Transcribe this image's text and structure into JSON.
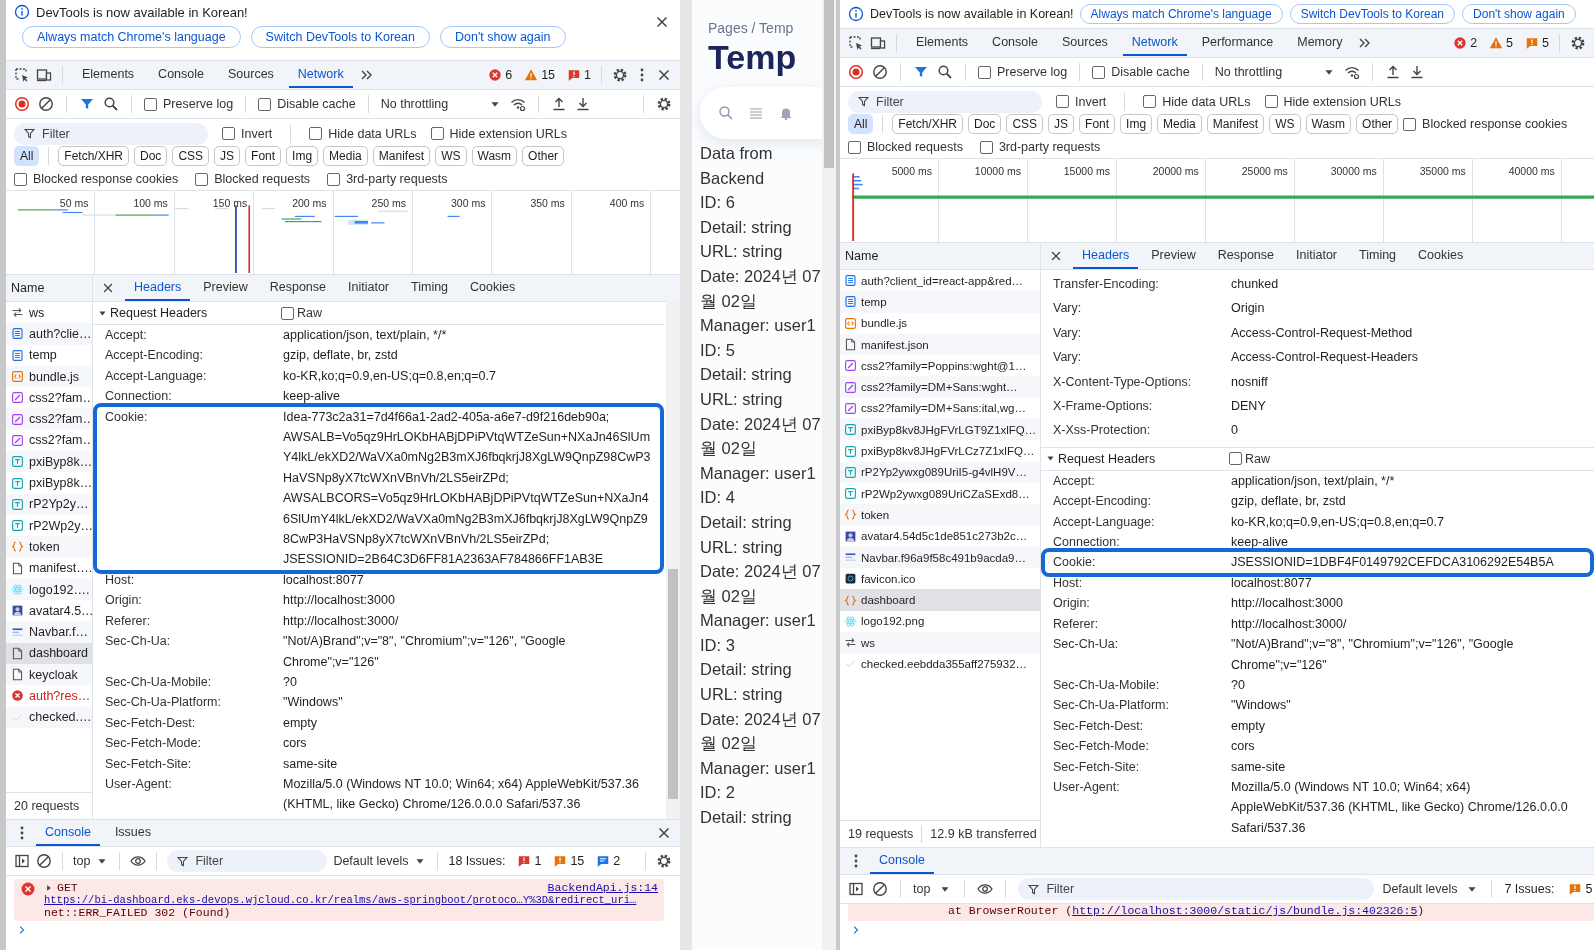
{
  "devtools": [
    {
      "infobar": {
        "message": "DevTools is now available in Korean!",
        "buttons": [
          "Always match Chrome's language",
          "Switch DevTools to Korean",
          "Don't show again"
        ]
      },
      "tabs": [
        {
          "label": "Elements",
          "selected": false
        },
        {
          "label": "Console",
          "selected": false
        },
        {
          "label": "Sources",
          "selected": false
        },
        {
          "label": "Network",
          "selected": true
        }
      ],
      "counts": [
        {
          "kind": "error",
          "text": "6"
        },
        {
          "kind": "warning",
          "text": "15"
        },
        {
          "kind": "error_issue",
          "text": "1"
        }
      ],
      "toolbar_checks": [
        {
          "label": "Preserve log",
          "checked": false
        },
        {
          "label": "Disable cache",
          "checked": false
        }
      ],
      "throttling": "No throttling",
      "filter": {
        "placeholder": "Filter"
      },
      "filter_checks": [
        {
          "label": "Invert",
          "checked": false
        },
        {
          "label": "Hide data URLs",
          "checked": false
        },
        {
          "label": "Hide extension URLs",
          "checked": false
        }
      ],
      "types": [
        {
          "label": "All",
          "selected": true
        },
        {
          "label": "Fetch/XHR",
          "selected": false
        },
        {
          "label": "Doc",
          "selected": false
        },
        {
          "label": "CSS",
          "selected": false
        },
        {
          "label": "JS",
          "selected": false
        },
        {
          "label": "Font",
          "selected": false
        },
        {
          "label": "Img",
          "selected": false
        },
        {
          "label": "Media",
          "selected": false
        },
        {
          "label": "Manifest",
          "selected": false
        },
        {
          "label": "WS",
          "selected": false
        },
        {
          "label": "Wasm",
          "selected": false
        },
        {
          "label": "Other",
          "selected": false
        }
      ],
      "blocked_checks": [
        {
          "label": "Blocked response cookies",
          "checked": false
        },
        {
          "label": "Blocked requests",
          "checked": false
        },
        {
          "label": "3rd-party requests",
          "checked": false
        }
      ],
      "overview": {
        "kind": "burst",
        "ticks": [
          "50 ms",
          "100 ms",
          "150 ms",
          "200 ms",
          "250 ms",
          "300 ms",
          "350 ms",
          "400 ms"
        ]
      },
      "list_header": "Name",
      "requests": [
        {
          "name": "ws",
          "kind": "ws",
          "selected": false
        },
        {
          "name": "auth?clie…",
          "kind": "doc",
          "selected": false
        },
        {
          "name": "temp",
          "kind": "doc",
          "selected": false
        },
        {
          "name": "bundle.js",
          "kind": "script",
          "selected": false
        },
        {
          "name": "css2?fam…",
          "kind": "css",
          "selected": false
        },
        {
          "name": "css2?fam…",
          "kind": "css",
          "selected": false
        },
        {
          "name": "css2?fam…",
          "kind": "css",
          "selected": false
        },
        {
          "name": "pxiByp8k…",
          "kind": "font",
          "selected": false
        },
        {
          "name": "pxiByp8k…",
          "kind": "font",
          "selected": false
        },
        {
          "name": "rP2Yp2y…",
          "kind": "font",
          "selected": false
        },
        {
          "name": "rP2Wp2y…",
          "kind": "font",
          "selected": false
        },
        {
          "name": "token",
          "kind": "fetch",
          "selected": false
        },
        {
          "name": "manifest….",
          "kind": "file",
          "selected": false
        },
        {
          "name": "logo192….",
          "kind": "react",
          "selected": false
        },
        {
          "name": "avatar4.5…",
          "kind": "avatar",
          "selected": false
        },
        {
          "name": "Navbar.f…",
          "kind": "image",
          "selected": false
        },
        {
          "name": "dashboard",
          "kind": "file",
          "selected": true
        },
        {
          "name": "keycloak",
          "kind": "file",
          "selected": false
        },
        {
          "name": "auth?res…",
          "kind": "error",
          "selected": false
        },
        {
          "name": "checked.…",
          "kind": "check",
          "selected": false
        }
      ],
      "status": [
        "20 requests"
      ],
      "detail_tabs": [
        {
          "label": "Headers",
          "selected": true
        },
        {
          "label": "Preview",
          "selected": false
        },
        {
          "label": "Response",
          "selected": false
        },
        {
          "label": "Initiator",
          "selected": false
        },
        {
          "label": "Timing",
          "selected": false
        },
        {
          "label": "Cookies",
          "selected": false
        }
      ],
      "sections": [
        {
          "kind": "request",
          "title": "Request Headers",
          "expanded": true,
          "raw": {
            "label": "Raw",
            "checked": false
          },
          "rows": [
            {
              "name": "Accept:",
              "value": "application/json, text/plain, */*",
              "highlighted": false
            },
            {
              "name": "Accept-Encoding:",
              "value": "gzip, deflate, br, zstd",
              "highlighted": false
            },
            {
              "name": "Accept-Language:",
              "value": "ko-KR,ko;q=0.9,en-US;q=0.8,en;q=0.7",
              "highlighted": false
            },
            {
              "name": "Connection:",
              "value": "keep-alive",
              "highlighted": false
            },
            {
              "name": "Cookie:",
              "value": "Idea-773c2a31=7d4f66a1-2ad2-405a-a6e7-d9f216deb90a; AWSALB=Vo5qz9HrLOKbHABjDPiPVtqWTZeSun+NXaJn46SlUmY4lkL/ekXD2/WaVXa0mNg2B3mXJ6fbqkrjJ8XgLW9QnpZ98CwP3HaVSNp8yX7tcWXnVBnVh/2LS5eirZPd; AWSALBCORS=Vo5qz9HrLOKbHABjDPiPVtqWTZeSun+NXaJn46SlUmY4lkL/ekXD2/WaVXa0mNg2B3mXJ6fbqkrjJ8XgLW9QnpZ98CwP3HaVSNp8yX7tcWXnVBnVh/2LS5eirZPd; JSESSIONID=2B64C3D6FF81A2363AF784866FF1AB3E",
              "highlighted": true
            },
            {
              "name": "Host:",
              "value": "localhost:8077",
              "highlighted": false
            },
            {
              "name": "Origin:",
              "value": "http://localhost:3000",
              "highlighted": false
            },
            {
              "name": "Referer:",
              "value": "http://localhost:3000/",
              "highlighted": false
            },
            {
              "name": "Sec-Ch-Ua:",
              "value": "\"Not/A)Brand\";v=\"8\", \"Chromium\";v=\"126\", \"Google Chrome\";v=\"126\"",
              "highlighted": false
            },
            {
              "name": "Sec-Ch-Ua-Mobile:",
              "value": "?0",
              "highlighted": false
            },
            {
              "name": "Sec-Ch-Ua-Platform:",
              "value": "\"Windows\"",
              "highlighted": false
            },
            {
              "name": "Sec-Fetch-Dest:",
              "value": "empty",
              "highlighted": false
            },
            {
              "name": "Sec-Fetch-Mode:",
              "value": "cors",
              "highlighted": false
            },
            {
              "name": "Sec-Fetch-Site:",
              "value": "same-site",
              "highlighted": false
            },
            {
              "name": "User-Agent:",
              "value": "Mozilla/5.0 (Windows NT 10.0; Win64; x64) AppleWebKit/537.36 (KHTML, like Gecko) Chrome/126.0.0.0 Safari/537.36",
              "highlighted": false
            }
          ]
        }
      ],
      "drawer": {
        "tabs": [
          {
            "label": "Console",
            "selected": true
          },
          {
            "label": "Issues",
            "selected": false
          }
        ],
        "context": "top",
        "filter": {
          "placeholder": "Filter"
        },
        "levels": "Default levels",
        "issues_label": "18 Issues:",
        "issue_counts": [
          {
            "kind": "error_issue",
            "text": "1"
          },
          {
            "kind": "warning_issue",
            "text": "15"
          },
          {
            "kind": "info_issue",
            "text": "2"
          }
        ],
        "messages": [
          {
            "kind": "error",
            "summary": "GET",
            "source": "BackendApi.js:14",
            "url": "https://bi-dashboard.eks-devops.wjcloud.co.kr/realms/aws-springboot/protoco…Y%3D&redirect_uri…",
            "detail": "net::ERR_FAILED 302 (Found)"
          }
        ]
      }
    },
    {
      "infobar": {
        "message": "DevTools is now available in Korean!",
        "buttons": [
          "Always match Chrome's language",
          "Switch DevTools to Korean",
          "Don't show again"
        ]
      },
      "tabs": [
        {
          "label": "Elements",
          "selected": false
        },
        {
          "label": "Console",
          "selected": false
        },
        {
          "label": "Sources",
          "selected": false
        },
        {
          "label": "Network",
          "selected": true
        },
        {
          "label": "Performance",
          "selected": false
        },
        {
          "label": "Memory",
          "selected": false
        }
      ],
      "counts": [
        {
          "kind": "error",
          "text": "2"
        },
        {
          "kind": "warning",
          "text": "5"
        },
        {
          "kind": "warning_issue",
          "text": "5"
        }
      ],
      "toolbar_checks": [
        {
          "label": "Preserve log",
          "checked": false
        },
        {
          "label": "Disable cache",
          "checked": false
        }
      ],
      "throttling": "No throttling",
      "filter": {
        "placeholder": "Filter"
      },
      "filter_checks": [
        {
          "label": "Invert",
          "checked": false
        },
        {
          "label": "Hide data URLs",
          "checked": false
        },
        {
          "label": "Hide extension URLs",
          "checked": false
        }
      ],
      "types": [
        {
          "label": "All",
          "selected": true
        },
        {
          "label": "Fetch/XHR",
          "selected": false
        },
        {
          "label": "Doc",
          "selected": false
        },
        {
          "label": "CSS",
          "selected": false
        },
        {
          "label": "JS",
          "selected": false
        },
        {
          "label": "Font",
          "selected": false
        },
        {
          "label": "Img",
          "selected": false
        },
        {
          "label": "Media",
          "selected": false
        },
        {
          "label": "Manifest",
          "selected": false
        },
        {
          "label": "WS",
          "selected": false
        },
        {
          "label": "Wasm",
          "selected": false
        },
        {
          "label": "Other",
          "selected": false
        }
      ],
      "blocked_checks": [
        {
          "label": "Blocked response cookies",
          "checked": false
        },
        {
          "label": "Blocked requests",
          "checked": false
        },
        {
          "label": "3rd-party requests",
          "checked": false
        }
      ],
      "overview": {
        "kind": "long",
        "ticks": [
          "5000 ms",
          "10000 ms",
          "15000 ms",
          "20000 ms",
          "25000 ms",
          "30000 ms",
          "35000 ms",
          "40000 ms"
        ]
      },
      "list_header": "Name",
      "requests": [
        {
          "name": "auth?client_id=react-app&red…",
          "kind": "doc",
          "selected": false
        },
        {
          "name": "temp",
          "kind": "doc",
          "selected": false
        },
        {
          "name": "bundle.js",
          "kind": "script",
          "selected": false
        },
        {
          "name": "manifest.json",
          "kind": "file",
          "selected": false
        },
        {
          "name": "css2?family=Poppins:wght@1…",
          "kind": "css",
          "selected": false
        },
        {
          "name": "css2?family=DM+Sans:wght…",
          "kind": "css",
          "selected": false
        },
        {
          "name": "css2?family=DM+Sans:ital,wg…",
          "kind": "css",
          "selected": false
        },
        {
          "name": "pxiByp8kv8JHgFVrLGT9Z1xlFQ…",
          "kind": "font",
          "selected": false
        },
        {
          "name": "pxiByp8kv8JHgFVrLCz7Z1xlFQ…",
          "kind": "font",
          "selected": false
        },
        {
          "name": "rP2Yp2ywxg089UriI5-g4vlH9V…",
          "kind": "font",
          "selected": false
        },
        {
          "name": "rP2Wp2ywxg089UriCZaSExd8…",
          "kind": "font",
          "selected": false
        },
        {
          "name": "token",
          "kind": "fetch",
          "selected": false
        },
        {
          "name": "avatar4.54d5c1de851c273b2c…",
          "kind": "avatar",
          "selected": false
        },
        {
          "name": "Navbar.f96a9f58c491b9acda9…",
          "kind": "image",
          "selected": false
        },
        {
          "name": "favicon.ico",
          "kind": "favicon",
          "selected": false
        },
        {
          "name": "dashboard",
          "kind": "fetch",
          "selected": true
        },
        {
          "name": "logo192.png",
          "kind": "react",
          "selected": false
        },
        {
          "name": "ws",
          "kind": "ws",
          "selected": false
        },
        {
          "name": "checked.eebdda355aff275932…",
          "kind": "check",
          "selected": false
        }
      ],
      "status": [
        "19 requests",
        "12.9 kB transferred"
      ],
      "detail_tabs": [
        {
          "label": "Headers",
          "selected": true
        },
        {
          "label": "Preview",
          "selected": false
        },
        {
          "label": "Response",
          "selected": false
        },
        {
          "label": "Initiator",
          "selected": false
        },
        {
          "label": "Timing",
          "selected": false
        },
        {
          "label": "Cookies",
          "selected": false
        }
      ],
      "sections": [
        {
          "kind": "response",
          "rows": [
            {
              "name": "Transfer-Encoding:",
              "value": "chunked",
              "highlighted": false
            },
            {
              "name": "Vary:",
              "value": "Origin",
              "highlighted": false
            },
            {
              "name": "Vary:",
              "value": "Access-Control-Request-Method",
              "highlighted": false
            },
            {
              "name": "Vary:",
              "value": "Access-Control-Request-Headers",
              "highlighted": false
            },
            {
              "name": "X-Content-Type-Options:",
              "value": "nosniff",
              "highlighted": false
            },
            {
              "name": "X-Frame-Options:",
              "value": "DENY",
              "highlighted": false
            },
            {
              "name": "X-Xss-Protection:",
              "value": "0",
              "highlighted": false
            }
          ]
        },
        {
          "kind": "request",
          "title": "Request Headers",
          "expanded": true,
          "raw": {
            "label": "Raw",
            "checked": false
          },
          "rows": [
            {
              "name": "Accept:",
              "value": "application/json, text/plain, */*",
              "highlighted": false
            },
            {
              "name": "Accept-Encoding:",
              "value": "gzip, deflate, br, zstd",
              "highlighted": false
            },
            {
              "name": "Accept-Language:",
              "value": "ko-KR,ko;q=0.9,en-US;q=0.8,en;q=0.7",
              "highlighted": false
            },
            {
              "name": "Connection:",
              "value": "keep-alive",
              "highlighted": false
            },
            {
              "name": "Cookie:",
              "value": "JSESSIONID=1DBF4F0149792CEFDCA3106292E54B5A",
              "highlighted": true
            },
            {
              "name": "Host:",
              "value": "localhost:8077",
              "highlighted": false
            },
            {
              "name": "Origin:",
              "value": "http://localhost:3000",
              "highlighted": false
            },
            {
              "name": "Referer:",
              "value": "http://localhost:3000/",
              "highlighted": false
            },
            {
              "name": "Sec-Ch-Ua:",
              "value": "\"Not/A)Brand\";v=\"8\", \"Chromium\";v=\"126\", \"Google Chrome\";v=\"126\"",
              "highlighted": false
            },
            {
              "name": "Sec-Ch-Ua-Mobile:",
              "value": "?0",
              "highlighted": false
            },
            {
              "name": "Sec-Ch-Ua-Platform:",
              "value": "\"Windows\"",
              "highlighted": false
            },
            {
              "name": "Sec-Fetch-Dest:",
              "value": "empty",
              "highlighted": false
            },
            {
              "name": "Sec-Fetch-Mode:",
              "value": "cors",
              "highlighted": false
            },
            {
              "name": "Sec-Fetch-Site:",
              "value": "same-site",
              "highlighted": false
            },
            {
              "name": "User-Agent:",
              "value": "Mozilla/5.0 (Windows NT 10.0; Win64; x64) AppleWebKit/537.36 (KHTML, like Gecko) Chrome/126.0.0.0 Safari/537.36",
              "highlighted": false
            }
          ]
        }
      ],
      "drawer": {
        "tabs": [
          {
            "label": "Console",
            "selected": true
          }
        ],
        "context": "top",
        "filter": {
          "placeholder": "Filter"
        },
        "levels": "Default levels",
        "issues_label": "7 Issues:",
        "issue_counts": [
          {
            "kind": "warning_issue",
            "text": "5"
          }
        ],
        "messages": [
          {
            "kind": "trace",
            "prefix": "at BrowserRouter (",
            "url": "http://localhost:3000/static/js/bundle.js:402326:5",
            "suffix": ")"
          }
        ]
      }
    }
  ],
  "page": {
    "breadcrumb": "Pages / Temp",
    "title": "Temp",
    "heading": "Data from Backend",
    "records": [
      {
        "id": "ID: 6",
        "detail": "Detail: string",
        "url": "URL: string",
        "date": "Date: 2024년 07월 02일",
        "manager": "Manager: user1"
      },
      {
        "id": "ID: 5",
        "detail": "Detail: string",
        "url": "URL: string",
        "date": "Date: 2024년 07월 02일",
        "manager": "Manager: user1"
      },
      {
        "id": "ID: 4",
        "detail": "Detail: string",
        "url": "URL: string",
        "date": "Date: 2024년 07월 02일",
        "manager": "Manager: user1"
      },
      {
        "id": "ID: 3",
        "detail": "Detail: string",
        "url": "URL: string",
        "date": "Date: 2024년 07월 02일",
        "manager": "Manager: user1"
      },
      {
        "id": "ID: 2",
        "detail": "Detail: string"
      }
    ]
  }
}
